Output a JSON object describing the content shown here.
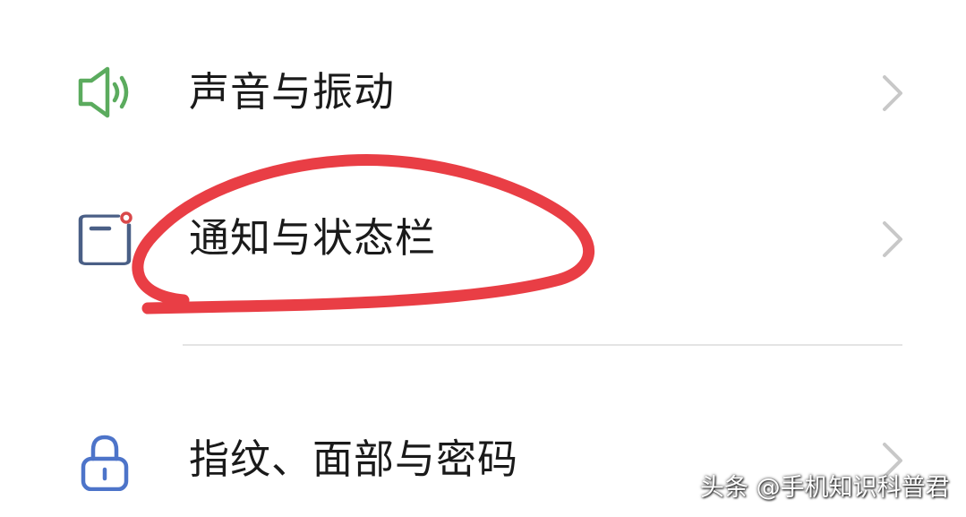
{
  "settings": {
    "items": [
      {
        "label": "声音与振动",
        "icon": "speaker-icon",
        "icon_color": "#5bab5e"
      },
      {
        "label": "通知与状态栏",
        "icon": "notification-icon",
        "icon_color": "#4a5f86",
        "badge_color": "#d9484a"
      },
      {
        "label": "指纹、面部与密码",
        "icon": "lock-icon",
        "icon_color": "#4d74c9"
      }
    ]
  },
  "annotation": {
    "shape": "hand-drawn ellipse",
    "color": "#e8343b"
  },
  "watermark": {
    "text": "头条 @手机知识科普君"
  },
  "colors": {
    "text": "#1a1a1a",
    "chevron": "#c8c8c8",
    "divider": "#e4e4e4"
  }
}
